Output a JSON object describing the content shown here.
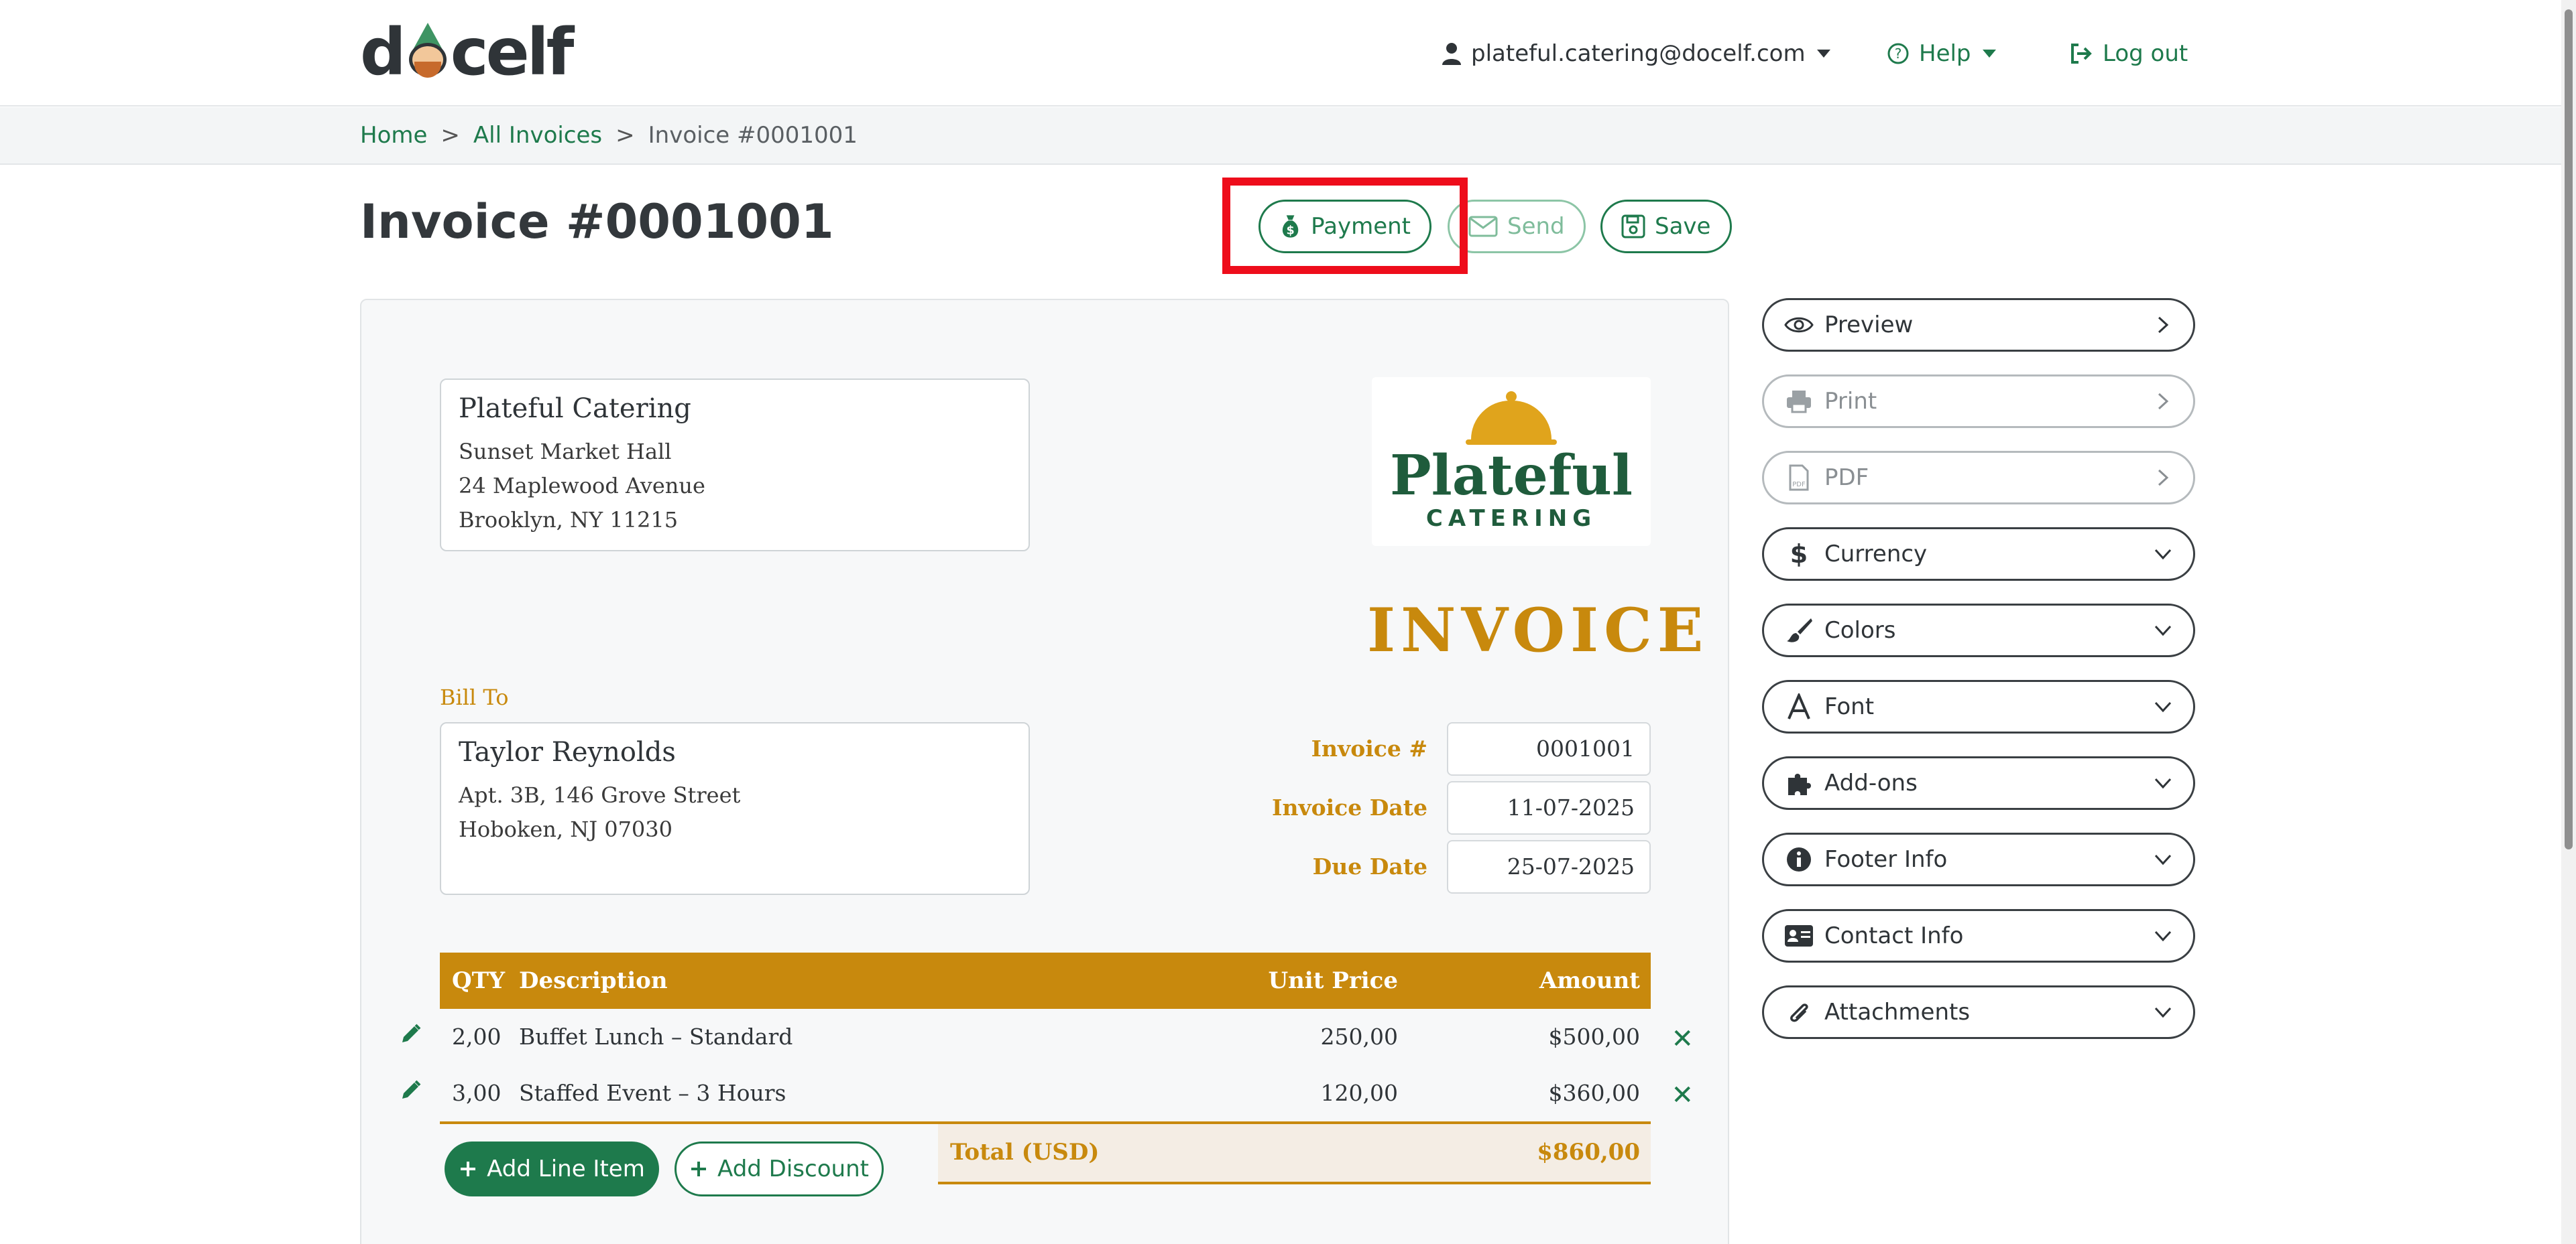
{
  "app": {
    "logo_text_left": "d",
    "logo_text_right": "celf"
  },
  "header": {
    "user_email": "plateful.catering@docelf.com",
    "help_label": "Help",
    "logout_label": "Log out"
  },
  "breadcrumb": {
    "home": "Home",
    "all_invoices": "All Invoices",
    "current": "Invoice #0001001",
    "separator": ">"
  },
  "page": {
    "title": "Invoice #0001001"
  },
  "toolbar": {
    "payment_label": "Payment",
    "send_label": "Send",
    "save_label": "Save"
  },
  "invoice": {
    "from": {
      "name": "Plateful Catering",
      "lines": [
        "Sunset Market Hall",
        "24 Maplewood Avenue",
        "Brooklyn, NY 11215"
      ]
    },
    "company_logo": {
      "big": "Plateful",
      "small": "CATERING"
    },
    "heading": "INVOICE",
    "bill_to_label": "Bill To",
    "bill_to": {
      "name": "Taylor Reynolds",
      "lines": [
        "Apt. 3B, 146 Grove Street",
        "Hoboken, NJ 07030"
      ]
    },
    "meta": {
      "number_label": "Invoice #",
      "number_value": "0001001",
      "date_label": "Invoice Date",
      "date_value": "11-07-2025",
      "due_label": "Due Date",
      "due_value": "25-07-2025"
    },
    "columns": {
      "qty": "QTY",
      "description": "Description",
      "unit_price": "Unit Price",
      "amount": "Amount"
    },
    "items": [
      {
        "qty": "2,00",
        "description": "Buffet Lunch – Standard",
        "unit_price": "250,00",
        "amount": "$500,00"
      },
      {
        "qty": "3,00",
        "description": "Staffed Event – 3 Hours",
        "unit_price": "120,00",
        "amount": "$360,00"
      }
    ],
    "total_label": "Total (USD)",
    "total_value": "$860,00",
    "add_line_label": "Add Line Item",
    "add_discount_label": "Add Discount",
    "delete_glyph": "✕"
  },
  "sidebar": {
    "items": [
      {
        "label": "Preview",
        "icon": "eye-icon",
        "chevron": "right",
        "enabled": true
      },
      {
        "label": "Print",
        "icon": "printer-icon",
        "chevron": "right",
        "enabled": false
      },
      {
        "label": "PDF",
        "icon": "pdf-file-icon",
        "chevron": "right",
        "enabled": false
      },
      {
        "label": "Currency",
        "icon": "dollar-icon",
        "chevron": "down",
        "enabled": true
      },
      {
        "label": "Colors",
        "icon": "paintbrush-icon",
        "chevron": "down",
        "enabled": true
      },
      {
        "label": "Font",
        "icon": "font-icon",
        "chevron": "down",
        "enabled": true
      },
      {
        "label": "Add-ons",
        "icon": "puzzle-icon",
        "chevron": "down",
        "enabled": true
      },
      {
        "label": "Footer Info",
        "icon": "info-icon",
        "chevron": "down",
        "enabled": true
      },
      {
        "label": "Contact Info",
        "icon": "contact-card-icon",
        "chevron": "down",
        "enabled": true
      },
      {
        "label": "Attachments",
        "icon": "paperclip-icon",
        "chevron": "down",
        "enabled": true
      }
    ]
  },
  "colors": {
    "brand_green": "#1e7a4c",
    "accent_gold": "#c8890d",
    "highlight_red": "#ee0d1b"
  }
}
